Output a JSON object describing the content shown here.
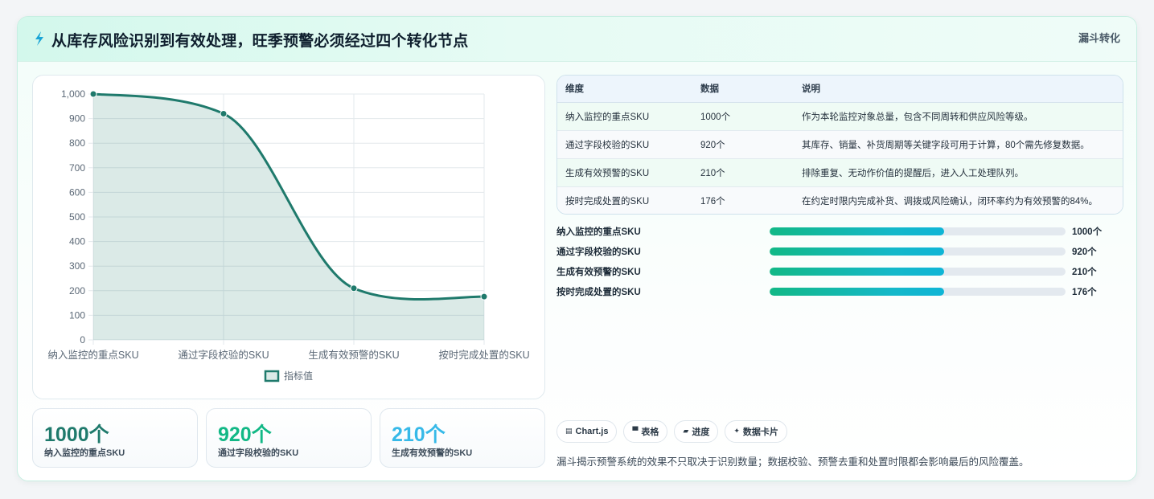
{
  "header": {
    "title": "从库存风险识别到有效处理，旺季预警必须经过四个转化节点",
    "tag": "漏斗转化"
  },
  "colors": {
    "line": "#1f7a6c",
    "area": "rgba(31,122,108,0.16)",
    "kpi_1": "#1f7a6c",
    "kpi_2": "#12b886",
    "kpi_3": "#36b9e8"
  },
  "chart_data": {
    "type": "area",
    "categories": [
      "纳入监控的重点SKU",
      "通过字段校验的SKU",
      "生成有效预警的SKU",
      "按时完成处置的SKU"
    ],
    "series": [
      {
        "name": "指标值",
        "values": [
          1000,
          920,
          210,
          176
        ]
      }
    ],
    "ylim": [
      0,
      1000
    ],
    "yticks": [
      "0",
      "100",
      "200",
      "300",
      "400",
      "500",
      "600",
      "700",
      "800",
      "900",
      "1,000"
    ],
    "grid": true,
    "legend_position": "bottom"
  },
  "table": {
    "headers": [
      "维度",
      "数据",
      "说明"
    ],
    "rows": [
      [
        "纳入监控的重点SKU",
        "1000个",
        "作为本轮监控对象总量，包含不同周转和供应风险等级。"
      ],
      [
        "通过字段校验的SKU",
        "920个",
        "其库存、销量、补货周期等关键字段可用于计算，80个需先修复数据。"
      ],
      [
        "生成有效预警的SKU",
        "210个",
        "排除重复、无动作价值的提醒后，进入人工处理队列。"
      ],
      [
        "按时完成处置的SKU",
        "176个",
        "在约定时限内完成补货、调拨或风险确认，闭环率约为有效预警的84%。"
      ]
    ]
  },
  "progress": [
    {
      "label": "纳入监控的重点SKU",
      "value_text": "1000个",
      "fill": 0.59
    },
    {
      "label": "通过字段校验的SKU",
      "value_text": "920个",
      "fill": 0.59
    },
    {
      "label": "生成有效预警的SKU",
      "value_text": "210个",
      "fill": 0.59
    },
    {
      "label": "按时完成处置的SKU",
      "value_text": "176个",
      "fill": 0.59
    }
  ],
  "kpis": [
    {
      "value": "1000个",
      "label": "纳入监控的重点SKU"
    },
    {
      "value": "920个",
      "label": "通过字段校验的SKU"
    },
    {
      "value": "210个",
      "label": "生成有效预警的SKU"
    }
  ],
  "chips": [
    {
      "icon": "▤",
      "icon_name": "chart-icon",
      "label": "Chart.js"
    },
    {
      "icon": "▀",
      "icon_name": "table-icon",
      "label": "表格"
    },
    {
      "icon": "▰",
      "icon_name": "progress-icon",
      "label": "进度"
    },
    {
      "icon": "✦",
      "icon_name": "sparkle-icon",
      "label": "数据卡片"
    }
  ],
  "footnote": "漏斗揭示预警系统的效果不只取决于识别数量；数据校验、预警去重和处置时限都会影响最后的风险覆盖。"
}
